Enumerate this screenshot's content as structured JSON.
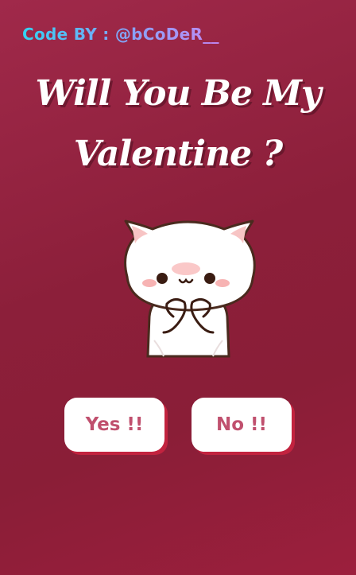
{
  "credit": {
    "text": "Code BY : @bCoDeR__"
  },
  "title": {
    "line1": "Will You Be My",
    "line2": "Valentine ?"
  },
  "image": {
    "icon": "cute-cat-sticker"
  },
  "buttons": {
    "yes_label": "Yes !!",
    "no_label": "No !!"
  },
  "colors": {
    "background": "#8c1f3a",
    "button_text": "#c0506e",
    "button_shadow": "#c2233f"
  }
}
